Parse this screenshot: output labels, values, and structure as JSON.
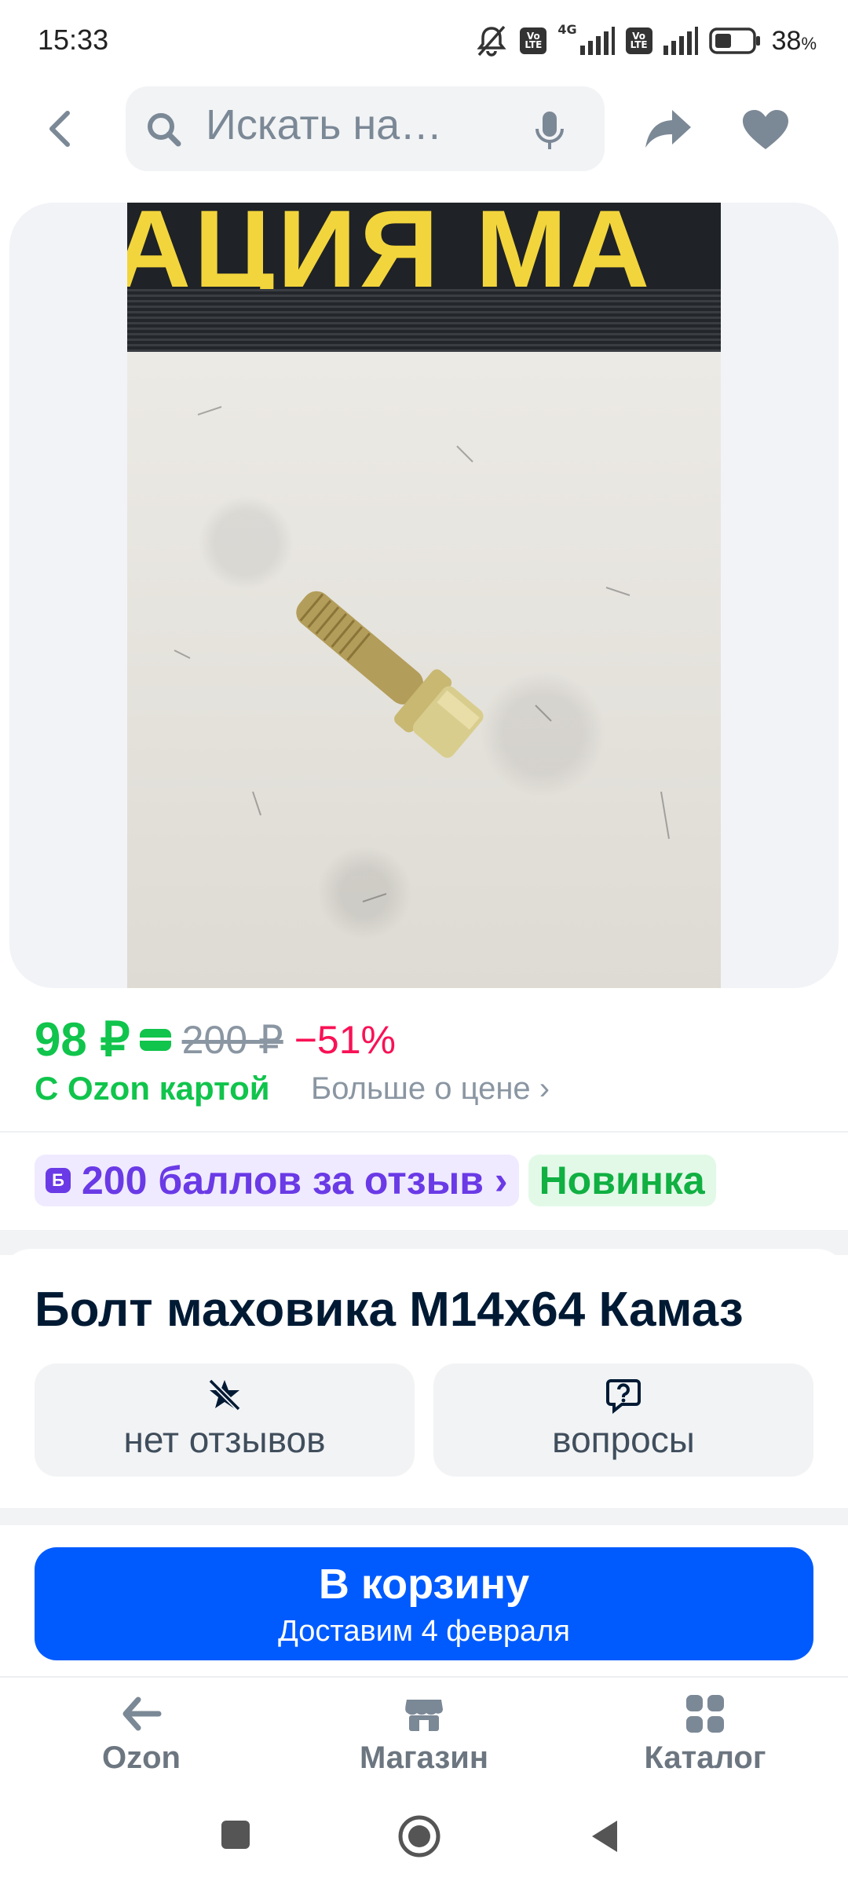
{
  "status_bar": {
    "time": "15:33",
    "network_label_1": "Vo LTE",
    "network_label_2": "4G",
    "network_label_3": "Vo LTE",
    "battery_percent": "38",
    "battery_unit": "%"
  },
  "header": {
    "search_placeholder": "Искать на…"
  },
  "gallery": {
    "photo_banner_text": "АЦИЯ МА"
  },
  "price": {
    "current": "98 ₽",
    "old": "200 ₽",
    "discount": "−51%",
    "ozon_card_label": "С Ozon картой",
    "more_link": "Больше о цене ›"
  },
  "badges": {
    "reviews_points_icon": "Б",
    "reviews_points": "200 баллов за отзыв ›",
    "new": "Новинка"
  },
  "product": {
    "title": "Болт маховика M14x64 Камаз",
    "reviews_chip": "нет отзывов",
    "questions_chip": "вопросы"
  },
  "cart": {
    "label": "В корзину",
    "delivery": "Доставим 4 февраля"
  },
  "bottom_nav": {
    "items": [
      {
        "label": "Ozon",
        "icon": "back-arrow-icon"
      },
      {
        "label": "Магазин",
        "icon": "store-icon"
      },
      {
        "label": "Каталог",
        "icon": "grid-icon"
      }
    ]
  },
  "colors": {
    "accent": "#005bff",
    "price_green": "#10c44c",
    "discount_red": "#f91155",
    "points_purple": "#6a3ae6"
  }
}
